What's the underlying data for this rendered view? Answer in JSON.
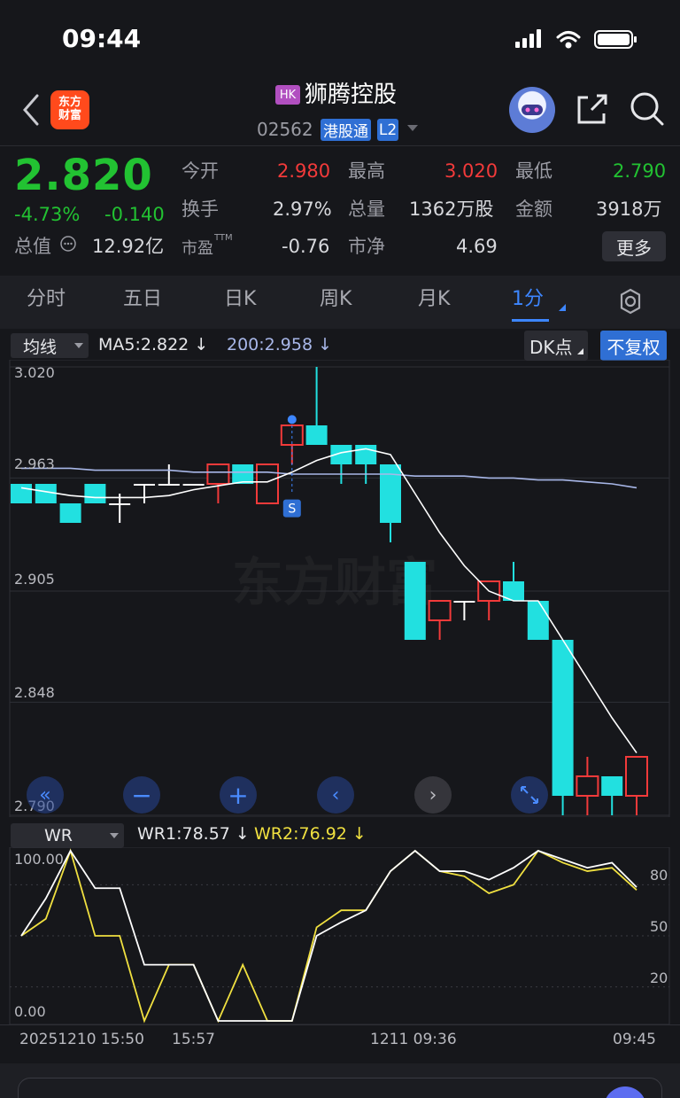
{
  "status_bar": {
    "time": "09:44"
  },
  "header": {
    "logo_text": "东方财富",
    "market_badge": "HK",
    "stock_name": "狮腾控股",
    "stock_code": "02562",
    "tag_connect": "港股通",
    "tag_level": "L2"
  },
  "quote": {
    "price": "2.820",
    "change_pct": "-4.73%",
    "change_amt": "-0.140",
    "cap_label": "总值",
    "cap_value": "12.92亿",
    "open_label": "今开",
    "open_value": "2.980",
    "high_label": "最高",
    "high_value": "3.020",
    "low_label": "最低",
    "low_value": "2.790",
    "turnover_label": "换手",
    "turnover_value": "2.97%",
    "volume_label": "总量",
    "volume_value": "1362万股",
    "amount_label": "金额",
    "amount_value": "3918万",
    "pe_label": "市盈",
    "pe_sup": "TTM",
    "pe_value": "-0.76",
    "pb_label": "市净",
    "pb_value": "4.69",
    "more_label": "更多"
  },
  "tabs": [
    "分时",
    "五日",
    "日K",
    "周K",
    "月K",
    "1分"
  ],
  "active_tab": "1分",
  "main_chart_header": {
    "indicator": "均线",
    "ma5": "MA5:2.822",
    "ma200": "200:2.958",
    "dk_label": "DK点",
    "adjust_label": "不复权"
  },
  "sub_chart_header": {
    "indicator": "WR",
    "wr1": "WR1:78.57",
    "wr2": "WR2:76.92"
  },
  "signal_marker": "S",
  "watermark": "东方财富",
  "time_axis": {
    "start": "20251210 15:50",
    "mid1": "15:57",
    "mid2": "1211 09:36",
    "end": "09:45"
  },
  "colors": {
    "up": "#f23a3a",
    "down": "#22e0e0",
    "ma5": "#ffffff",
    "ma200": "#a8b7e8",
    "wr1": "#ffffff",
    "wr2": "#f0e040",
    "accent": "#3d86ff"
  },
  "chart_data": [
    {
      "type": "candlestick",
      "y_ticks": [
        "3.020",
        "2.963",
        "2.905",
        "2.848",
        "2.790"
      ],
      "ylim": [
        2.79,
        3.02
      ],
      "candles": [
        {
          "o": 2.96,
          "c": 2.95,
          "h": 2.96,
          "l": 2.95
        },
        {
          "o": 2.96,
          "c": 2.95,
          "h": 2.96,
          "l": 2.95
        },
        {
          "o": 2.95,
          "c": 2.94,
          "h": 2.95,
          "l": 2.94
        },
        {
          "o": 2.96,
          "c": 2.95,
          "h": 2.96,
          "l": 2.95
        },
        {
          "o": 2.95,
          "c": 2.95,
          "h": 2.955,
          "l": 2.94
        },
        {
          "o": 2.96,
          "c": 2.96,
          "h": 2.96,
          "l": 2.95
        },
        {
          "o": 2.96,
          "c": 2.96,
          "h": 2.97,
          "l": 2.96
        },
        {
          "o": 2.96,
          "c": 2.96,
          "h": 2.96,
          "l": 2.96
        },
        {
          "o": 2.96,
          "c": 2.97,
          "h": 2.97,
          "l": 2.95
        },
        {
          "o": 2.97,
          "c": 2.96,
          "h": 2.97,
          "l": 2.96
        },
        {
          "o": 2.95,
          "c": 2.97,
          "h": 2.97,
          "l": 2.95
        },
        {
          "o": 2.98,
          "c": 2.99,
          "h": 2.99,
          "l": 2.97
        },
        {
          "o": 2.99,
          "c": 2.98,
          "h": 3.02,
          "l": 2.98
        },
        {
          "o": 2.98,
          "c": 2.97,
          "h": 2.98,
          "l": 2.96
        },
        {
          "o": 2.98,
          "c": 2.97,
          "h": 2.98,
          "l": 2.96
        },
        {
          "o": 2.97,
          "c": 2.94,
          "h": 2.97,
          "l": 2.93
        },
        {
          "o": 2.92,
          "c": 2.88,
          "h": 2.92,
          "l": 2.88
        },
        {
          "o": 2.89,
          "c": 2.9,
          "h": 2.9,
          "l": 2.88
        },
        {
          "o": 2.9,
          "c": 2.9,
          "h": 2.9,
          "l": 2.89
        },
        {
          "o": 2.9,
          "c": 2.91,
          "h": 2.91,
          "l": 2.89
        },
        {
          "o": 2.91,
          "c": 2.9,
          "h": 2.92,
          "l": 2.9
        },
        {
          "o": 2.9,
          "c": 2.88,
          "h": 2.9,
          "l": 2.88
        },
        {
          "o": 2.88,
          "c": 2.8,
          "h": 2.88,
          "l": 2.79
        },
        {
          "o": 2.8,
          "c": 2.81,
          "h": 2.82,
          "l": 2.79
        },
        {
          "o": 2.81,
          "c": 2.8,
          "h": 2.81,
          "l": 2.79
        },
        {
          "o": 2.8,
          "c": 2.82,
          "h": 2.82,
          "l": 2.79
        }
      ],
      "ma5": [
        2.958,
        2.956,
        2.954,
        2.953,
        2.953,
        2.953,
        2.954,
        2.957,
        2.959,
        2.961,
        2.961,
        2.966,
        2.972,
        2.976,
        2.978,
        2.975,
        2.955,
        2.935,
        2.918,
        2.905,
        2.9,
        2.9,
        2.88,
        2.86,
        2.84,
        2.822
      ],
      "ma200": [
        2.968,
        2.968,
        2.968,
        2.967,
        2.967,
        2.967,
        2.967,
        2.966,
        2.966,
        2.966,
        2.966,
        2.965,
        2.965,
        2.965,
        2.965,
        2.965,
        2.964,
        2.964,
        2.964,
        2.963,
        2.963,
        2.962,
        2.962,
        2.961,
        2.96,
        2.958
      ]
    },
    {
      "type": "line",
      "y_ticks": [
        "100.00",
        "80",
        "50",
        "20",
        "0.00"
      ],
      "ylim": [
        0,
        100
      ],
      "series": [
        {
          "name": "WR1",
          "values": [
            50,
            72,
            100,
            78,
            78,
            33,
            33,
            33,
            0,
            0,
            0,
            0,
            50,
            58,
            65,
            88,
            100,
            88,
            88,
            83,
            90,
            100,
            95,
            90,
            93,
            78.57
          ]
        },
        {
          "name": "WR2",
          "values": [
            50,
            60,
            100,
            50,
            50,
            0,
            33,
            33,
            0,
            33,
            0,
            0,
            55,
            65,
            65,
            88,
            100,
            88,
            85,
            75,
            80,
            100,
            93,
            88,
            90,
            76.92
          ]
        }
      ]
    }
  ]
}
